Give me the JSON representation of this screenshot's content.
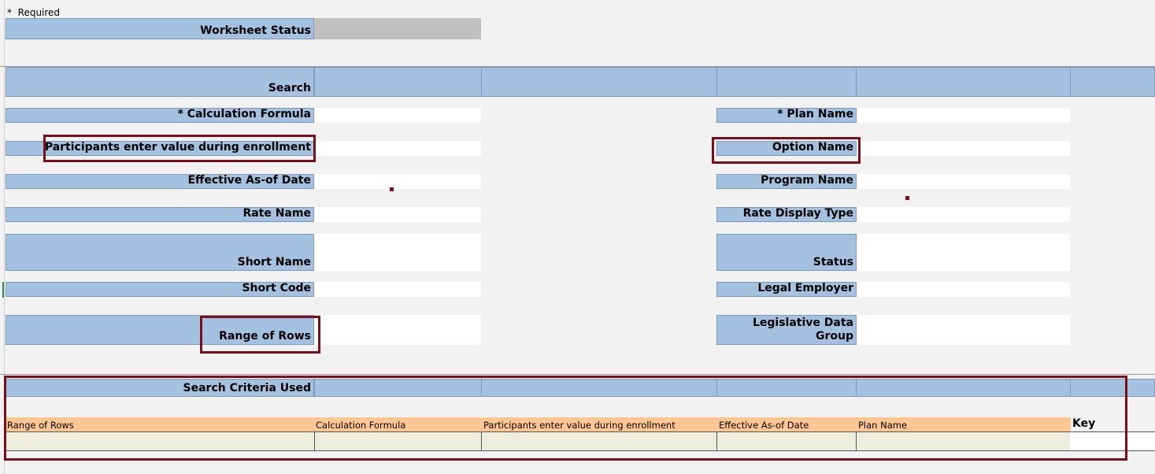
{
  "required_note": {
    "star": "*",
    "text": "Required"
  },
  "worksheet_status": {
    "label": "Worksheet Status",
    "value": ""
  },
  "search": {
    "label": "Search"
  },
  "left_fields": [
    {
      "label": "* Calculation Formula",
      "value": ""
    },
    {
      "label": "Participants enter value during enrollment",
      "value": ""
    },
    {
      "label": "Effective As-of Date",
      "value": ""
    },
    {
      "label": "Rate Name",
      "value": ""
    },
    {
      "label": "Short Name",
      "value": ""
    },
    {
      "label": "Short Code",
      "value": ""
    },
    {
      "label": "Range of Rows",
      "value": ""
    }
  ],
  "right_fields": [
    {
      "label": "* Plan Name",
      "value": ""
    },
    {
      "label": "Option Name",
      "value": ""
    },
    {
      "label": "Program Name",
      "value": ""
    },
    {
      "label": "Rate Display Type",
      "value": ""
    },
    {
      "label": "Status",
      "value": ""
    },
    {
      "label": "Legal Employer",
      "value": ""
    },
    {
      "label": "Legislative Data Group",
      "value": ""
    }
  ],
  "search_criteria": {
    "label": "Search Criteria Used",
    "columns": [
      "Range of Rows",
      "Calculation Formula",
      "Participants enter value during enrollment",
      "Effective As-of Date",
      "Plan Name"
    ],
    "key_label": "Key"
  },
  "colors": {
    "label_fill": "#a4c2e0",
    "header_fill": "#fdc692",
    "highlight_border": "#7a0f1c",
    "status_fill": "#c0c0c0"
  }
}
